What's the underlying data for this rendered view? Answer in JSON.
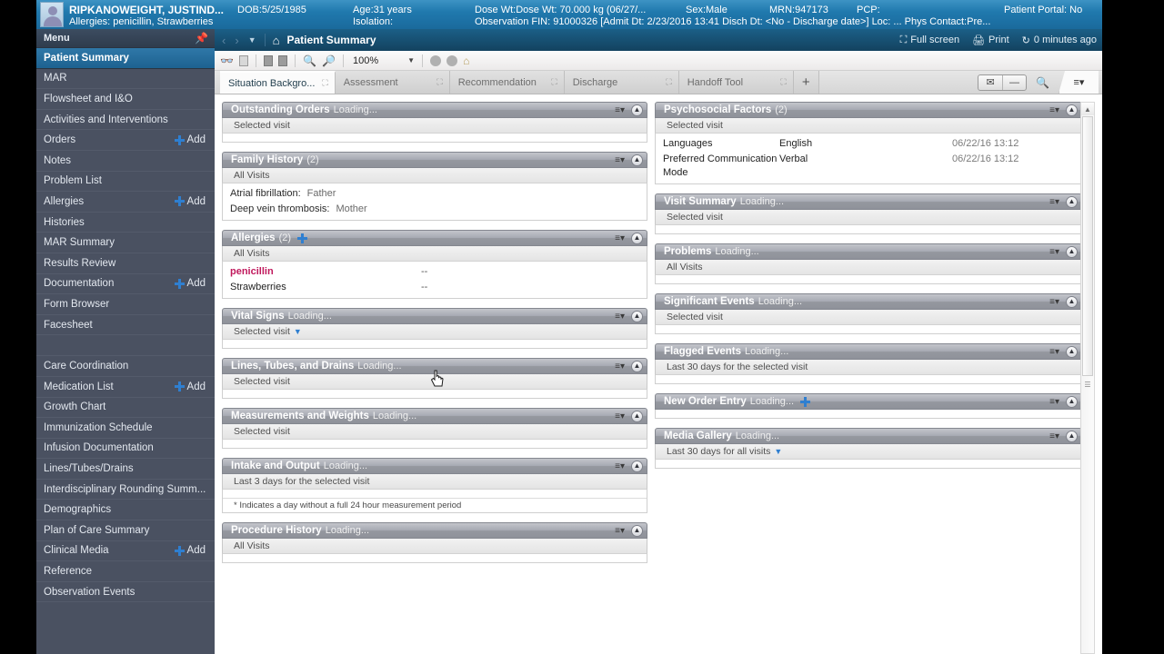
{
  "banner": {
    "patient_name": "RIPKANOWEIGHT, JUSTIND...",
    "dob": "DOB:5/25/1985",
    "age": "Age:31 years",
    "dose_wt": "Dose Wt:Dose Wt: 70.000 kg (06/27/...",
    "sex": "Sex:Male",
    "mrn": "MRN:947173",
    "pcp": "PCP:",
    "patient_portal": "Patient Portal: No",
    "allergies": "Allergies: penicillin, Strawberries",
    "isolation": "Isolation:",
    "observation_fin": "Observation FIN: 91000326 [Admit Dt: 2/23/2016 13:41 Disch Dt: <No - Discharge date>] Loc: ... Phys Contact:Pre...",
    "avatar_icon": "person-avatar-icon"
  },
  "sidebar": {
    "header": "Menu",
    "pin_icon": "pin-icon",
    "add_label": "Add",
    "items": [
      {
        "label": "Patient Summary",
        "active": true,
        "add": false
      },
      {
        "label": "MAR",
        "add": false
      },
      {
        "label": "Flowsheet and I&O",
        "add": false
      },
      {
        "label": "Activities and Interventions",
        "add": false
      },
      {
        "label": "Orders",
        "add": true
      },
      {
        "label": "Notes",
        "add": false
      },
      {
        "label": "Problem List",
        "add": false
      },
      {
        "label": "Allergies",
        "add": true
      },
      {
        "label": "Histories",
        "add": false
      },
      {
        "label": "MAR Summary",
        "add": false
      },
      {
        "label": "Results Review",
        "add": false
      },
      {
        "label": "Documentation",
        "add": true
      },
      {
        "label": "Form Browser",
        "add": false
      },
      {
        "label": "Facesheet",
        "add": false
      },
      {
        "spacer": true
      },
      {
        "label": "Care Coordination",
        "add": false
      },
      {
        "label": "Medication List",
        "add": true
      },
      {
        "label": "Growth Chart",
        "add": false
      },
      {
        "label": "Immunization Schedule",
        "add": false
      },
      {
        "label": "Infusion Documentation",
        "add": false
      },
      {
        "label": "Lines/Tubes/Drains",
        "add": false
      },
      {
        "label": "Interdisciplinary Rounding Summ...",
        "add": false
      },
      {
        "label": "Demographics",
        "add": false
      },
      {
        "label": "Plan of Care Summary",
        "add": false
      },
      {
        "label": "Clinical Media",
        "add": true
      },
      {
        "label": "Reference",
        "add": false
      },
      {
        "label": "Observation Events",
        "add": false
      }
    ]
  },
  "navbar": {
    "back_icon": "chevron-left-icon",
    "forward_icon": "chevron-right-icon",
    "history_caret_icon": "caret-down-icon",
    "home_icon": "home-icon",
    "title": "Patient Summary",
    "full_screen": "Full screen",
    "full_screen_icon": "full-screen-icon",
    "print": "Print",
    "print_icon": "printer-icon",
    "refresh": "0 minutes ago",
    "refresh_icon": "refresh-icon"
  },
  "toolbar": {
    "binoculars_icon": "binoculars-icon",
    "page_icon": "page-icon",
    "prev_page_icon": "previous-page-icon",
    "next_page_icon": "next-page-icon",
    "zoom_out_icon": "zoom-out-icon",
    "zoom_in_icon": "zoom-in-icon",
    "zoom_level": "100%",
    "zoom_dropdown_icon": "caret-down-icon",
    "circle1_icon": "circle-icon",
    "circle2_icon": "circle-icon",
    "home_icon": "home-icon"
  },
  "tabs": {
    "items": [
      {
        "label": "Situation Backgro...",
        "active": true,
        "close_icon": "expand-icon"
      },
      {
        "label": "Assessment",
        "active": false,
        "close_icon": "expand-icon"
      },
      {
        "label": "Recommendation",
        "active": false,
        "close_icon": "expand-icon"
      },
      {
        "label": "Discharge",
        "active": false,
        "close_icon": "expand-icon"
      },
      {
        "label": "Handoff Tool",
        "active": false,
        "close_icon": "expand-icon"
      }
    ],
    "add_tab_icon": "plus-icon",
    "message_icon": "envelope-icon",
    "minimize_icon": "minimize-icon",
    "search_icon": "search-icon",
    "menu_icon": "hamburger-menu-icon"
  },
  "columns": {
    "left": [
      {
        "title": "Outstanding Orders",
        "status": "Loading...",
        "filter": "Selected visit",
        "rows": []
      },
      {
        "title": "Family History",
        "count": "(2)",
        "filter": "All Visits",
        "rows": [
          {
            "key": "Atrial fibrillation:",
            "value": "Father"
          },
          {
            "key": "Deep vein thrombosis:",
            "value": "Mother"
          }
        ]
      },
      {
        "title": "Allergies",
        "count": "(2)",
        "add_icon": "plus-icon",
        "filter": "All Visits",
        "allergy_rows": [
          {
            "name": "penicillin",
            "reaction": "--",
            "severe": true
          },
          {
            "name": "Strawberries",
            "reaction": "--",
            "severe": false
          }
        ]
      },
      {
        "title": "Vital Signs",
        "status": "Loading...",
        "filter": "Selected visit",
        "filter_caret": true,
        "rows": []
      },
      {
        "title": "Lines, Tubes, and Drains",
        "status": "Loading...",
        "filter": "Selected visit",
        "rows": []
      },
      {
        "title": "Measurements and Weights",
        "status": "Loading...",
        "filter": "Selected visit",
        "rows": []
      },
      {
        "title": "Intake and Output",
        "status": "Loading...",
        "filter": "Last 3 days for the selected visit",
        "note": "* Indicates a day without a full 24 hour measurement period",
        "rows": []
      },
      {
        "title": "Procedure History",
        "status": "Loading...",
        "filter": "All Visits",
        "rows": []
      }
    ],
    "right": [
      {
        "title": "Psychosocial Factors",
        "count": "(2)",
        "filter": "Selected visit",
        "ps_rows": [
          {
            "key": "Languages",
            "value": "English",
            "time": "06/22/16 13:12"
          },
          {
            "key": "Preferred Communication Mode",
            "value": "Verbal",
            "time": "06/22/16 13:12"
          }
        ]
      },
      {
        "title": "Visit Summary",
        "status": "Loading...",
        "filter": "Selected visit",
        "rows": []
      },
      {
        "title": "Problems",
        "status": "Loading...",
        "filter": "All Visits",
        "rows": []
      },
      {
        "title": "Significant Events",
        "status": "Loading...",
        "filter": "Selected visit",
        "rows": []
      },
      {
        "title": "Flagged Events",
        "status": "Loading...",
        "filter": "Last 30 days for the selected visit",
        "rows": []
      },
      {
        "title": "New Order Entry",
        "status": "Loading...",
        "add_icon": "plus-icon",
        "rows": []
      },
      {
        "title": "Media Gallery",
        "status": "Loading...",
        "filter": "Last 30 days for all visits",
        "filter_caret": true,
        "rows": []
      }
    ]
  },
  "scrollbar": {
    "up_icon": "scroll-up-icon",
    "down_icon": "scroll-down-icon"
  },
  "cursor": {
    "icon": "hand-pointer-cursor"
  },
  "colors": {
    "banner_blue": "#2079ae",
    "sidebar_bg": "#4a5161",
    "sidebar_active": "#2f78a8",
    "card_header_gray": "#95989f",
    "accent_blue": "#2f7fd0",
    "allergy_red": "#c0185c"
  }
}
